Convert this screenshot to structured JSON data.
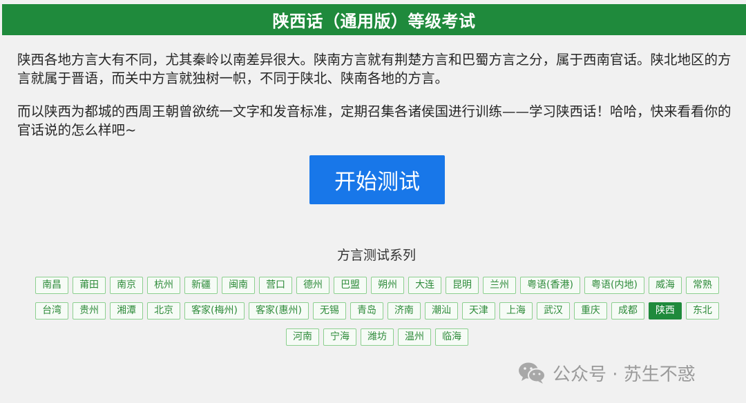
{
  "header": {
    "title": "陕西话（通用版）等级考试"
  },
  "intro": {
    "paragraph1": "陕西各地方言大有不同，尤其秦岭以南差异很大。陕南方言就有荆楚方言和巴蜀方言之分，属于西南官话。陕北地区的方言就属于晋语，而关中方言就独树一帜，不同于陕北、陕南各地的方言。",
    "paragraph2": "而以陕西为都城的西周王朝曾欲统一文字和发音标准，定期召集各诸侯国进行训练——学习陕西话！哈哈，快来看看你的官话说的怎么样吧~"
  },
  "start_button": {
    "label": "开始测试"
  },
  "series": {
    "title": "方言测试系列",
    "selected": "陕西",
    "row1": [
      "南昌",
      "莆田",
      "南京",
      "杭州",
      "新疆",
      "闽南",
      "营口",
      "德州",
      "巴盟",
      "朔州",
      "大连",
      "昆明",
      "兰州",
      "粤语(香港)",
      "粤语(内地)",
      "威海",
      "常熟"
    ],
    "row2": [
      "台湾",
      "贵州",
      "湘潭",
      "北京",
      "客家(梅州)",
      "客家(惠州)",
      "无锡",
      "青岛",
      "济南",
      "潮汕",
      "天津",
      "上海",
      "武汉",
      "重庆",
      "成都",
      "陕西",
      "东北"
    ],
    "row3": [
      "河南",
      "宁海",
      "潍坊",
      "温州",
      "临海"
    ]
  },
  "watermark": {
    "text": "公众号 · 苏生不惑",
    "icon": "wechat-icon"
  },
  "colors": {
    "header_green": "#1f8a3c",
    "button_blue": "#1877e9",
    "tag_green": "#2e8b3a"
  }
}
